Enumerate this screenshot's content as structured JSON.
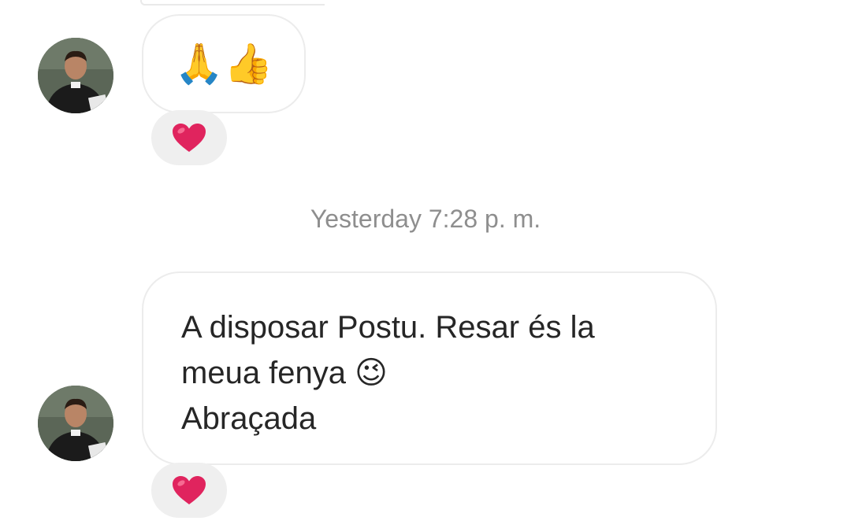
{
  "conversation": {
    "timestamp": "Yesterday 7:28 p. m.",
    "messages": [
      {
        "sender": "other",
        "emoji_text": "🙏👍",
        "reaction": {
          "icon": "heart-icon",
          "color": "#e0245e"
        }
      },
      {
        "sender": "other",
        "lines": [
          "A disposar Postu. Resar és la",
          "meua fenya",
          "Abraçada"
        ],
        "inline_emoji": "😉",
        "reaction": {
          "icon": "heart-icon",
          "color": "#e0245e"
        }
      }
    ]
  },
  "colors": {
    "bubble_border": "#ececec",
    "reaction_bg": "#efefef",
    "timestamp": "#8e8e8e",
    "text": "#262626"
  }
}
